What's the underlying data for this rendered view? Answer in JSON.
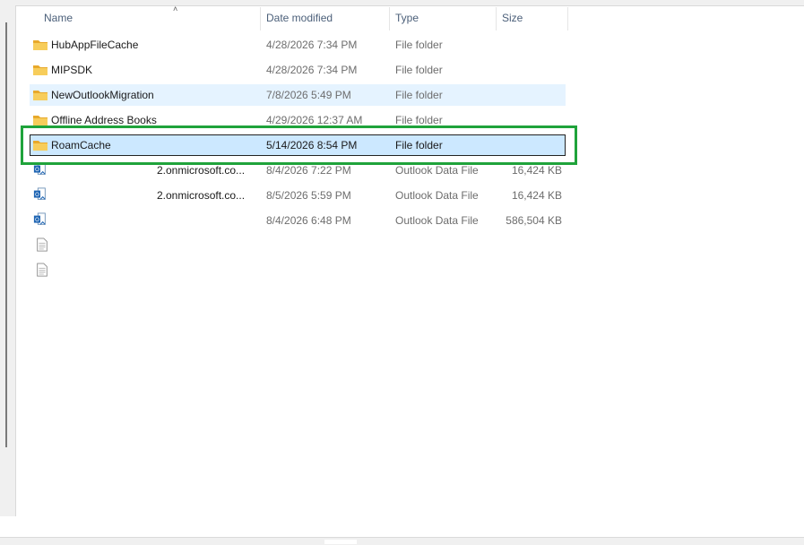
{
  "columns": {
    "name": "Name",
    "date_modified": "Date modified",
    "type": "Type",
    "size": "Size"
  },
  "sort": {
    "column": "Name",
    "direction": "ascending"
  },
  "rows": [
    {
      "name": "HubAppFileCache",
      "date": "4/28/2026 7:34 PM",
      "type": "File folder",
      "size": "",
      "icon": "folder-icon"
    },
    {
      "name": "MIPSDK",
      "date": "4/28/2026 7:34 PM",
      "type": "File folder",
      "size": "",
      "icon": "folder-icon"
    },
    {
      "name": "NewOutlookMigration",
      "date": "7/8/2026 5:49 PM",
      "type": "File folder",
      "size": "",
      "icon": "folder-icon"
    },
    {
      "name": "Offline Address Books",
      "date": "4/29/2026 12:37 AM",
      "type": "File folder",
      "size": "",
      "icon": "folder-icon"
    },
    {
      "name": "RoamCache",
      "date": "5/14/2026 8:54 PM",
      "type": "File folder",
      "size": "",
      "icon": "folder-icon"
    },
    {
      "name": "2.onmicrosoft.co...",
      "date": "8/4/2026 7:22 PM",
      "type": "Outlook Data File",
      "size": "16,424 KB",
      "icon": "outlook-data-file-icon"
    },
    {
      "name": "2.onmicrosoft.co...",
      "date": "8/5/2026 5:59 PM",
      "type": "Outlook Data File",
      "size": "16,424 KB",
      "icon": "outlook-data-file-icon"
    },
    {
      "name": "",
      "date": "8/4/2026 6:48 PM",
      "type": "Outlook Data File",
      "size": "586,504 KB",
      "icon": "outlook-data-file-icon"
    },
    {
      "name": "",
      "date": "",
      "type": "",
      "size": "",
      "icon": "text-document-icon"
    },
    {
      "name": "",
      "date": "",
      "type": "",
      "size": "",
      "icon": "text-document-icon"
    }
  ],
  "hovered_row": "NewOutlookMigration",
  "selected_row": "RoamCache",
  "colors": {
    "selection": "#cce8ff",
    "hover": "#e5f3ff",
    "annotation": "#1fa33b",
    "folder": "#f3c44f"
  }
}
